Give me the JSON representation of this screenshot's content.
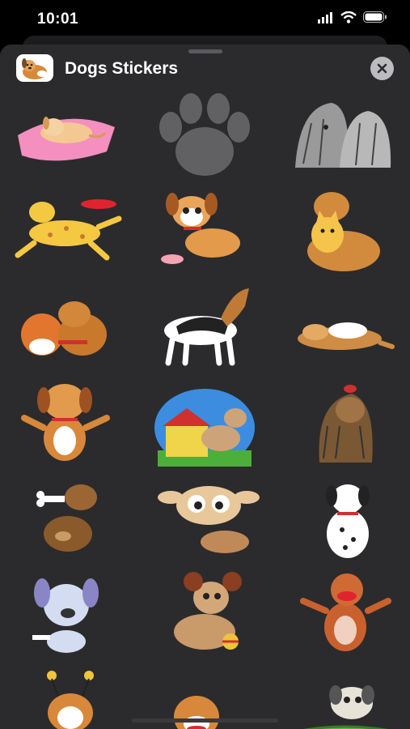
{
  "status": {
    "time": "10:01"
  },
  "header": {
    "title": "Dogs Stickers"
  },
  "stickers": [
    "sleeping-puppy-on-pillow",
    "paw-print",
    "shaggy-grey-dogs",
    "spotted-dog-catching-frisbee",
    "running-puppy",
    "dog-and-cat-hugging",
    "cat-and-dog-cuddling",
    "howling-beagle",
    "lying-dog",
    "happy-puppy-open-arms",
    "dog-at-doghouse",
    "yorkshire-terrier",
    "puppy-with-bone",
    "big-eyed-puppy",
    "dalmatian",
    "blue-puppy-with-bone",
    "puppy-with-ball",
    "standing-red-dog",
    "puppy-with-antennae",
    "brown-puppy",
    "puppy-in-basket"
  ]
}
